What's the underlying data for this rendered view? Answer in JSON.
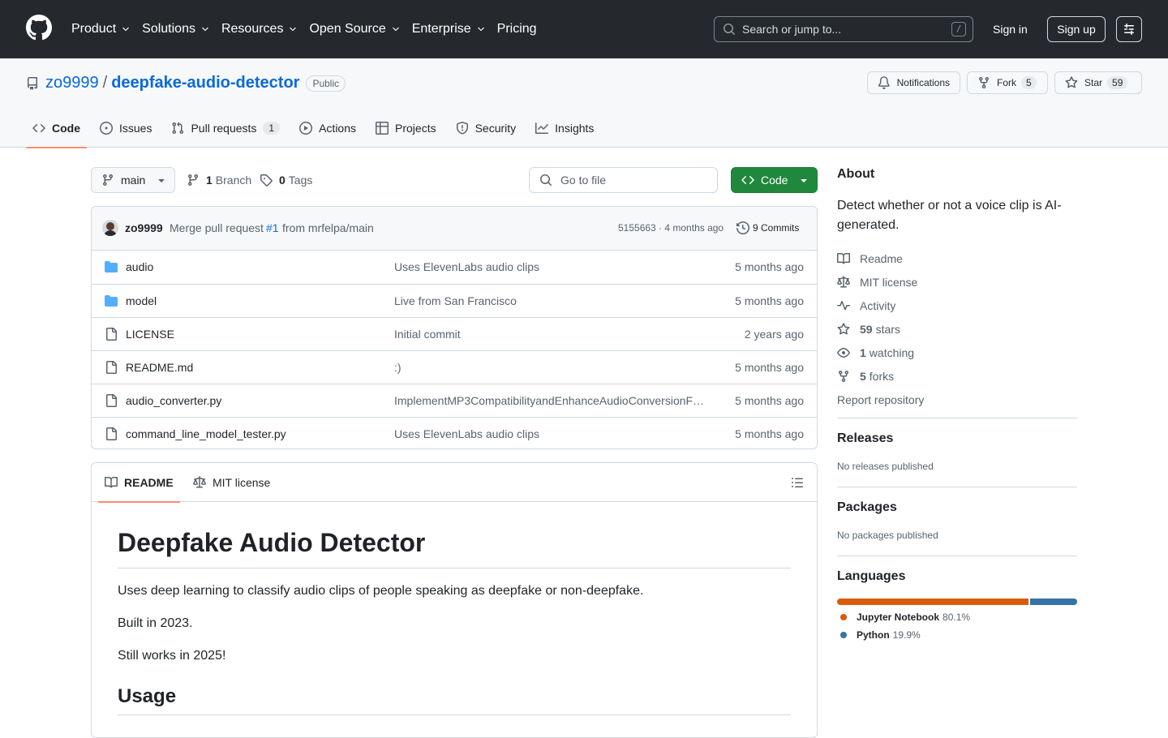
{
  "header": {
    "nav": [
      "Product",
      "Solutions",
      "Resources",
      "Open Source",
      "Enterprise",
      "Pricing"
    ],
    "search_placeholder": "Search or jump to...",
    "search_shortcut": "/",
    "sign_in": "Sign in",
    "sign_up": "Sign up"
  },
  "repo": {
    "owner": "zo9999",
    "separator": "/",
    "name": "deepfake-audio-detector",
    "visibility": "Public",
    "notifications_label": "Notifications",
    "fork_label": "Fork",
    "fork_count": "5",
    "star_label": "Star",
    "star_count": "59"
  },
  "tabs": {
    "code": "Code",
    "issues": "Issues",
    "pulls": "Pull requests",
    "pulls_count": "1",
    "actions": "Actions",
    "projects": "Projects",
    "security": "Security",
    "insights": "Insights"
  },
  "toolbar": {
    "branch": "main",
    "branch_count": "1",
    "branch_label": "Branch",
    "tag_count": "0",
    "tag_label": "Tags",
    "go_to_file": "Go to file",
    "code_button": "Code"
  },
  "commit": {
    "author": "zo9999",
    "message_prefix": "Merge pull request",
    "pr_link": "#1",
    "message_suffix": "from mrfelpa/main",
    "meta": "5155663 · 4 months ago",
    "commits_label": "9 Commits"
  },
  "files": [
    {
      "type": "folder",
      "name": "audio",
      "message": "Uses ElevenLabs audio clips",
      "date": "5 months ago"
    },
    {
      "type": "folder",
      "name": "model",
      "message": "Live from San Francisco",
      "date": "5 months ago"
    },
    {
      "type": "file",
      "name": "LICENSE",
      "message": "Initial commit",
      "date": "2 years ago"
    },
    {
      "type": "file",
      "name": "README.md",
      "message": ":)",
      "date": "5 months ago"
    },
    {
      "type": "file",
      "name": "audio_converter.py",
      "message": "ImplementMP3CompatibilityandEnhanceAudioConversionFunctionality",
      "date": "5 months ago"
    },
    {
      "type": "file",
      "name": "command_line_model_tester.py",
      "message": "Uses ElevenLabs audio clips",
      "date": "5 months ago"
    }
  ],
  "readme": {
    "tab_readme": "README",
    "tab_license": "MIT license",
    "title": "Deepfake Audio Detector",
    "p1": "Uses deep learning to classify audio clips of people speaking as deepfake or non-deepfake.",
    "p2": "Built in 2023.",
    "p3": "Still works in 2025!",
    "h2": "Usage"
  },
  "about": {
    "heading": "About",
    "description": "Detect whether or not a voice clip is AI-generated.",
    "readme": "Readme",
    "license": "MIT license",
    "activity": "Activity",
    "stars_count": "59",
    "stars_label": "stars",
    "watching_count": "1",
    "watching_label": "watching",
    "forks_count": "5",
    "forks_label": "forks",
    "report": "Report repository"
  },
  "releases": {
    "heading": "Releases",
    "text": "No releases published"
  },
  "packages": {
    "heading": "Packages",
    "text": "No packages published"
  },
  "languages": {
    "heading": "Languages",
    "items": [
      {
        "name": "Jupyter Notebook",
        "percent": "80.1%",
        "value": 80.1,
        "color": "#DA5B0B"
      },
      {
        "name": "Python",
        "percent": "19.9%",
        "value": 19.9,
        "color": "#3572A5"
      }
    ]
  },
  "colors": {
    "header_bg": "#25292e",
    "accent_blue": "#0969da",
    "code_button_green": "#1f883d",
    "active_tab_underline": "#fd8c73",
    "folder_icon": "#54aeff"
  }
}
